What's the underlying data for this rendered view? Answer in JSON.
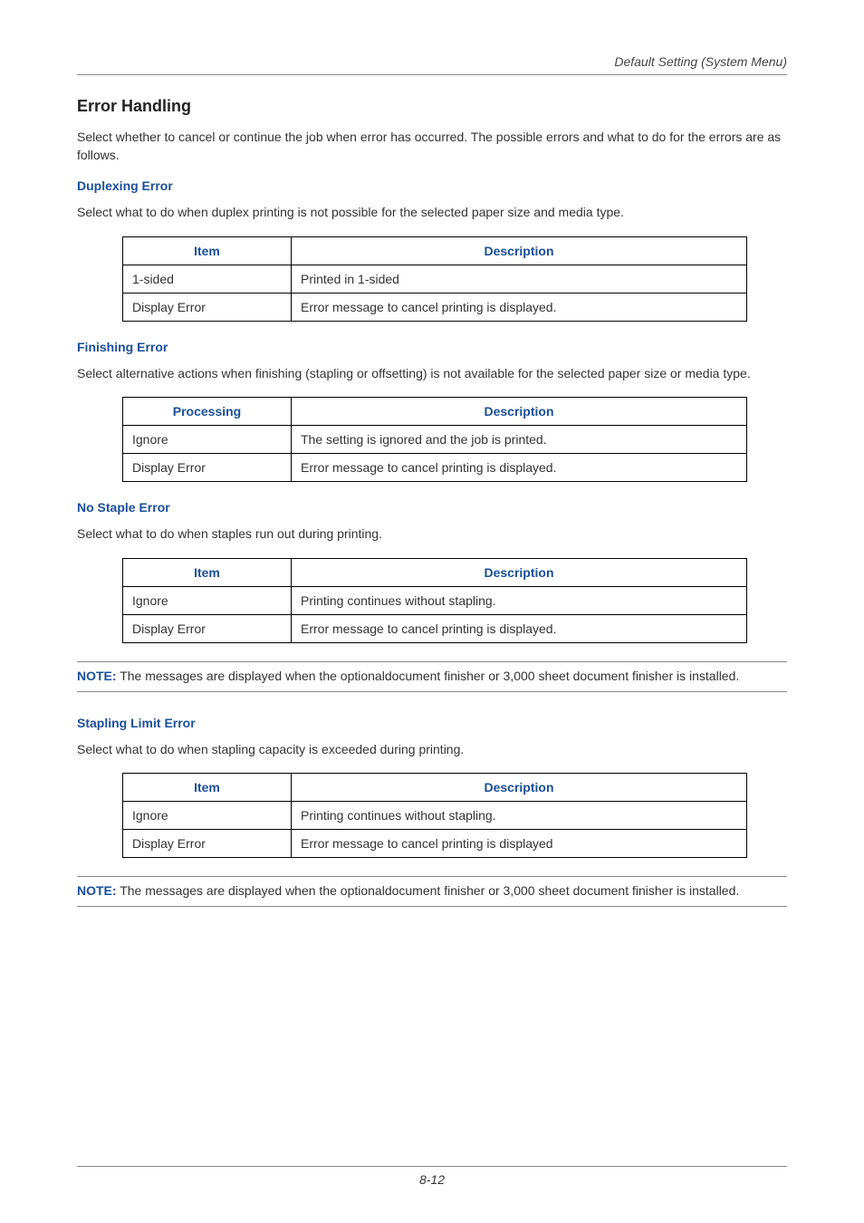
{
  "header": {
    "text": "Default Setting (System Menu)"
  },
  "title": "Error Handling",
  "intro": "Select whether to cancel or continue the job when error has occurred. The possible errors and what to do for the errors are as follows.",
  "sections": {
    "duplexing": {
      "heading": "Duplexing Error",
      "text": "Select what to do when duplex printing is not possible for the selected paper size and media type.",
      "col1": "Item",
      "col2": "Description",
      "rows": [
        {
          "item": "1-sided",
          "desc": "Printed in 1-sided"
        },
        {
          "item": "Display Error",
          "desc": "Error message to cancel printing is displayed."
        }
      ]
    },
    "finishing": {
      "heading": "Finishing Error",
      "text": "Select alternative actions when finishing (stapling or offsetting) is not available for the selected paper size or media type.",
      "col1": "Processing",
      "col2": "Description",
      "rows": [
        {
          "item": "Ignore",
          "desc": "The setting is ignored and the job is printed."
        },
        {
          "item": "Display Error",
          "desc": "Error message to cancel printing is displayed."
        }
      ]
    },
    "nostaple": {
      "heading": "No Staple Error",
      "text": "Select what to do when staples run out during printing.",
      "col1": "Item",
      "col2": "Description",
      "rows": [
        {
          "item": "Ignore",
          "desc": "Printing continues without stapling."
        },
        {
          "item": "Display Error",
          "desc": "Error message to cancel printing is displayed."
        }
      ],
      "note_label": "NOTE:",
      "note_text": " The messages are displayed when the optionaldocument finisher or 3,000 sheet document finisher is installed."
    },
    "stapling_limit": {
      "heading": "Stapling Limit Error",
      "text": "Select what to do when stapling capacity is exceeded during printing.",
      "col1": "Item",
      "col2": "Description",
      "rows": [
        {
          "item": "Ignore",
          "desc": "Printing continues without stapling."
        },
        {
          "item": "Display Error",
          "desc": "Error message to cancel printing is displayed"
        }
      ],
      "note_label": "NOTE:",
      "note_text": " The messages are displayed when the optionaldocument finisher or 3,000 sheet document finisher is installed."
    }
  },
  "footer": {
    "page": "8-12"
  }
}
